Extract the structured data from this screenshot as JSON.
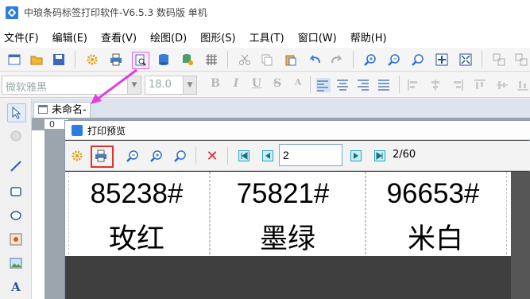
{
  "app": {
    "title": "中琅条码标签打印软件-V6.5.3 数码版 单机"
  },
  "menu": [
    "文件(F)",
    "编辑(E)",
    "查看(V)",
    "绘图(D)",
    "图形(S)",
    "工具(T)",
    "窗口(W)",
    "帮助(H)"
  ],
  "format_bar": {
    "font": "微软雅黑",
    "size": "18.0"
  },
  "doc": {
    "tab_label": "未命名-",
    "ruler_zero": "0"
  },
  "preview": {
    "title": "打印预览",
    "page_input": "2",
    "page_count": "2/60"
  },
  "labels": [
    {
      "code": "85238#",
      "color": "玫红"
    },
    {
      "code": "75821#",
      "color": "墨绿"
    },
    {
      "code": "96653#",
      "color": "米白"
    }
  ],
  "colors": {
    "accent": "#2a7de1",
    "highlight": "#e23030",
    "arrow": "#e040e0"
  }
}
